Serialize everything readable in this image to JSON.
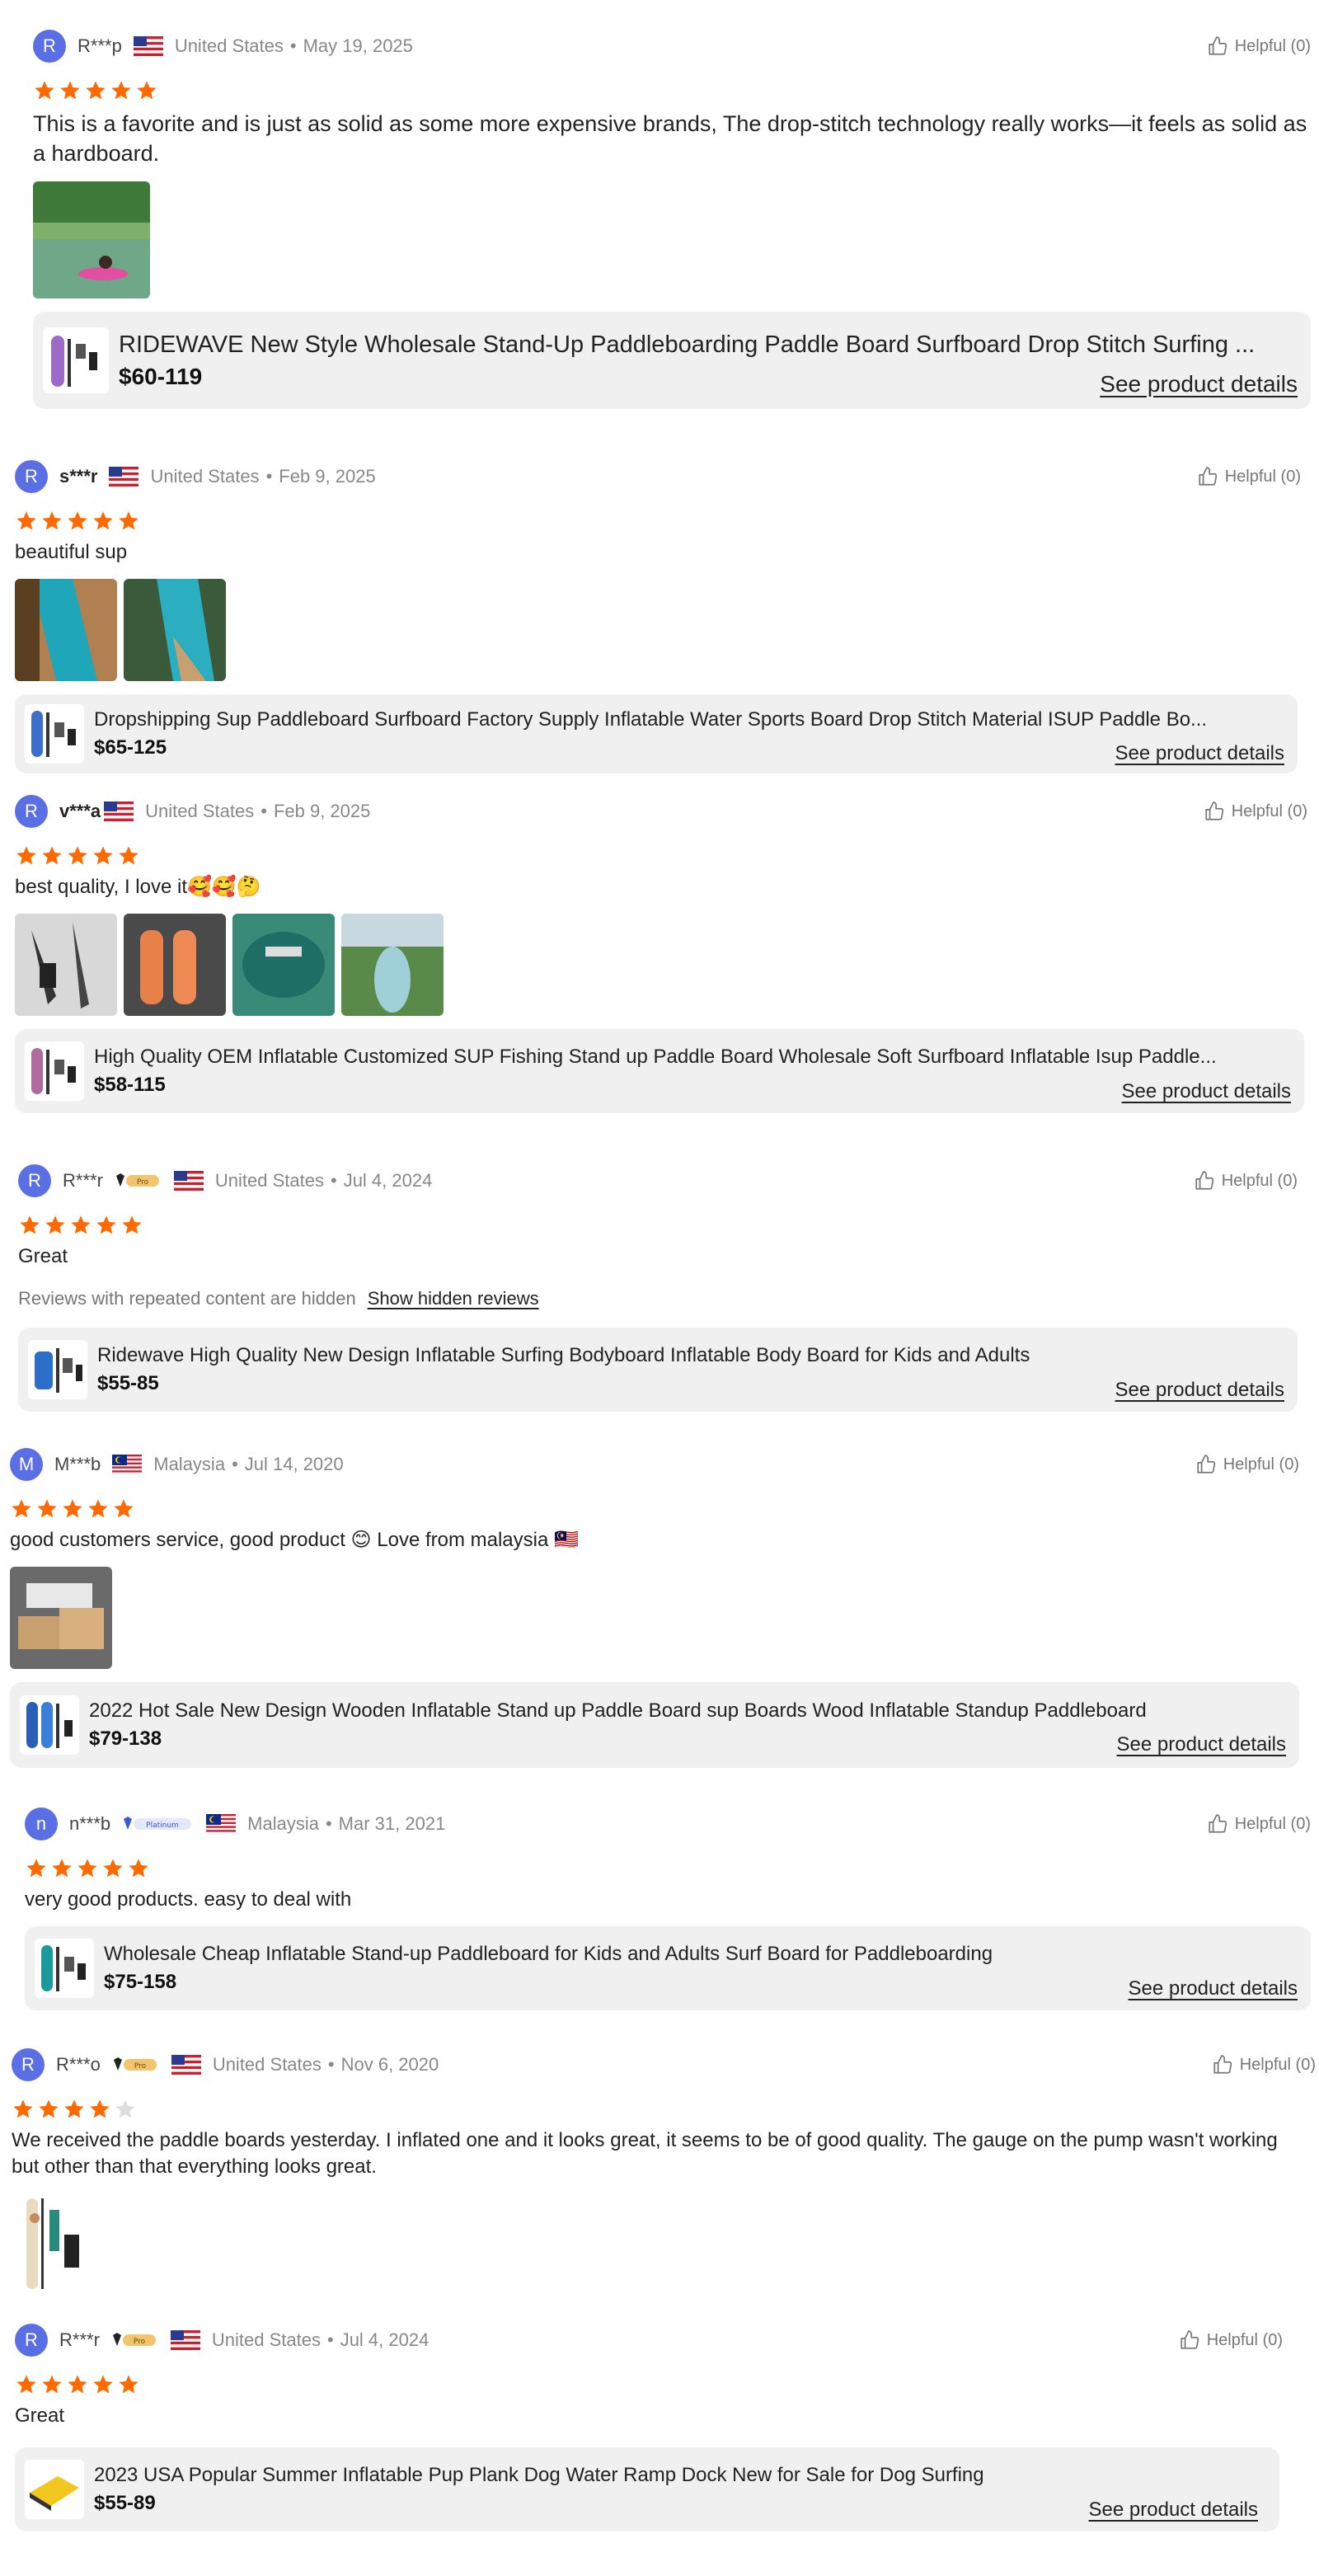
{
  "colors": {
    "star": "#ff6a00",
    "avatar": "#5a6fe3",
    "card_bg": "#f0f0f0"
  },
  "reviews": [
    {
      "avatar": "R",
      "user": "R***p",
      "flag": "us",
      "country": "United States",
      "date": "May 19, 2025",
      "helpful": "Helpful (0)",
      "rating": 5,
      "text": "This is a favorite and is just as solid as some more expensive brands, The drop-stitch technology really works—it feels as solid as a hardboard.",
      "product": {
        "title": "RIDEWAVE New Style Wholesale Stand-Up Paddleboarding Paddle Board Surfboard Drop Stitch Surfing ...",
        "price": "$60-119",
        "link": "See product details"
      }
    },
    {
      "avatar": "R",
      "user": "s***r",
      "flag": "us",
      "country": "United States",
      "date": "Feb 9, 2025",
      "helpful": "Helpful (0)",
      "rating": 5,
      "text": "beautiful sup",
      "product": {
        "title": "Dropshipping Sup Paddleboard Surfboard Factory Supply Inflatable Water Sports Board Drop Stitch Material ISUP Paddle Bo...",
        "price": "$65-125",
        "link": "See product details"
      }
    },
    {
      "avatar": "R",
      "user": "v***a",
      "flag": "us",
      "country": "United States",
      "date": "Feb 9, 2025",
      "helpful": "Helpful (0)",
      "rating": 5,
      "text": "best quality, I love it🥰🥰🤔",
      "product": {
        "title": "High Quality OEM Inflatable Customized SUP Fishing Stand up Paddle Board Wholesale Soft Surfboard Inflatable Isup Paddle...",
        "price": "$58-115",
        "link": "See product details"
      }
    },
    {
      "avatar": "R",
      "user": "R***r",
      "badge": "Pro",
      "flag": "us",
      "country": "United States",
      "date": "Jul 4, 2024",
      "helpful": "Helpful (0)",
      "rating": 5,
      "text": "Great",
      "hidden_note": "Reviews with repeated content are hidden",
      "hidden_link": "Show hidden reviews",
      "product": {
        "title": "Ridewave High Quality New Design Inflatable Surfing Bodyboard Inflatable Body Board for Kids and Adults",
        "price": "$55-85",
        "link": "See product details"
      }
    },
    {
      "avatar": "M",
      "user": "M***b",
      "flag": "my",
      "country": "Malaysia",
      "date": "Jul 14, 2020",
      "helpful": "Helpful (0)",
      "rating": 5,
      "text": "good customers service, good product 😊 Love from malaysia 🇲🇾",
      "product": {
        "title": "2022 Hot Sale New Design Wooden Inflatable Stand up Paddle Board sup Boards Wood Inflatable Standup Paddleboard",
        "price": "$79-138",
        "link": "See product details"
      }
    },
    {
      "avatar": "n",
      "user": "n***b",
      "badge": "Platinum",
      "flag": "my",
      "country": "Malaysia",
      "date": "Mar 31, 2021",
      "helpful": "Helpful (0)",
      "rating": 5,
      "text": "very good products. easy to deal with",
      "product": {
        "title": "Wholesale Cheap Inflatable Stand-up Paddleboard for Kids and Adults Surf Board for Paddleboarding",
        "price": "$75-158",
        "link": "See product details"
      }
    },
    {
      "avatar": "R",
      "user": "R***o",
      "badge": "Pro",
      "flag": "us",
      "country": "United States",
      "date": "Nov 6, 2020",
      "helpful": "Helpful (0)",
      "rating": 4,
      "text": "We received the paddle boards yesterday. I inflated one and it looks great, it seems to be of good quality. The gauge on the pump wasn't working but other than that everything looks great."
    },
    {
      "avatar": "R",
      "user": "R***r",
      "badge": "Pro",
      "flag": "us",
      "country": "United States",
      "date": "Jul 4, 2024",
      "helpful": "Helpful (0)",
      "rating": 5,
      "text": "Great",
      "product": {
        "title": "2023 USA Popular Summer Inflatable Pup Plank Dog Water Ramp Dock New for Sale for Dog Surfing",
        "price": "$55-89",
        "link": "See product details"
      }
    }
  ]
}
